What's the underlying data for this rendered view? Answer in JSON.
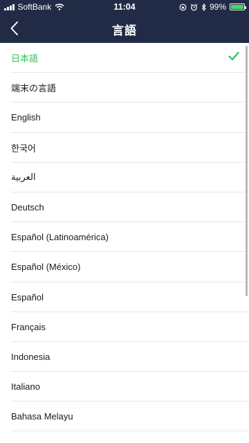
{
  "status_bar": {
    "carrier": "SoftBank",
    "time": "11:04",
    "battery": "99%",
    "battery_level": 0.99
  },
  "header": {
    "title": "言語",
    "back_icon": "chevron-left-icon"
  },
  "languages": [
    {
      "label": "日本語",
      "selected": true
    },
    {
      "label": "端末の言語",
      "selected": false
    },
    {
      "label": "English",
      "selected": false
    },
    {
      "label": "한국어",
      "selected": false
    },
    {
      "label": "العربية",
      "selected": false
    },
    {
      "label": "Deutsch",
      "selected": false
    },
    {
      "label": "Español (Latinoamérica)",
      "selected": false
    },
    {
      "label": "Español (México)",
      "selected": false
    },
    {
      "label": "Español",
      "selected": false
    },
    {
      "label": "Français",
      "selected": false
    },
    {
      "label": "Indonesia",
      "selected": false
    },
    {
      "label": "Italiano",
      "selected": false
    },
    {
      "label": "Bahasa Melayu",
      "selected": false
    }
  ],
  "colors": {
    "header_bg": "#212b45",
    "selected": "#2fbf5a",
    "battery": "#4cd964"
  }
}
